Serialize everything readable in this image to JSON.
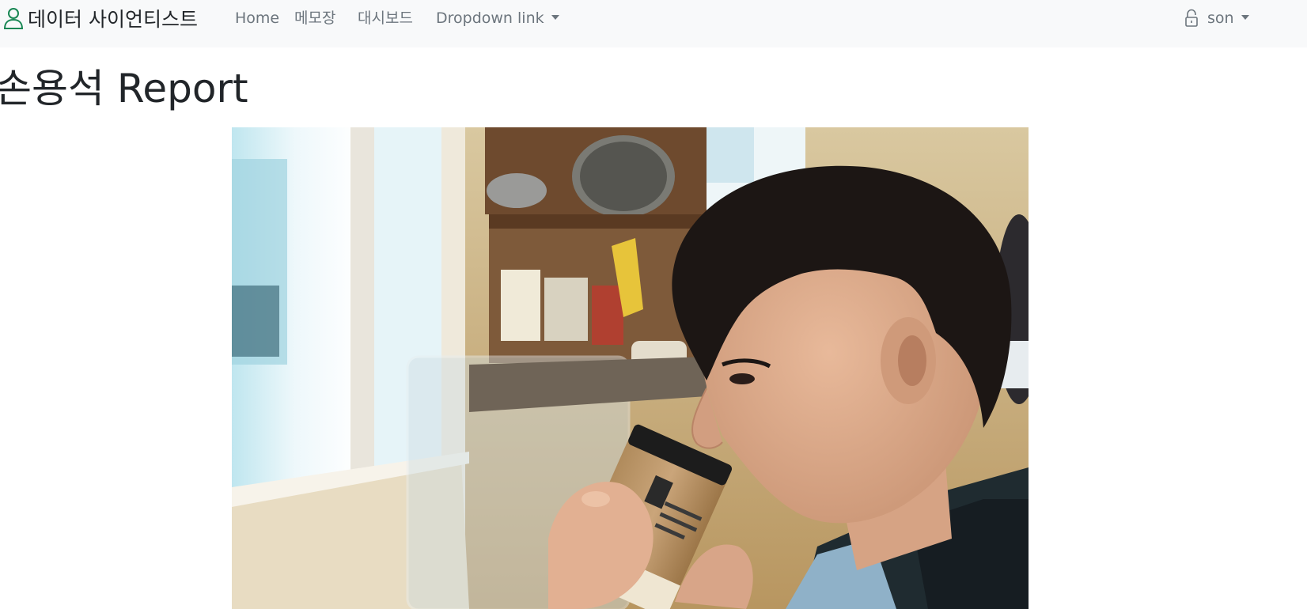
{
  "navbar": {
    "brand_label": "데이터 사이언티스트",
    "links": [
      {
        "label": "Home"
      },
      {
        "label": "메모장"
      },
      {
        "label": "대시보드"
      },
      {
        "label": "Dropdown link"
      }
    ],
    "user_label": "son"
  },
  "main": {
    "title": "손용석 Report",
    "photo_description_icon": "photo-of-man-drinking-coffee"
  },
  "colors": {
    "navbar_bg": "#f8f9fa",
    "brand_icon": "#198754",
    "link_text": "#6c757d",
    "title_text": "#212529"
  }
}
